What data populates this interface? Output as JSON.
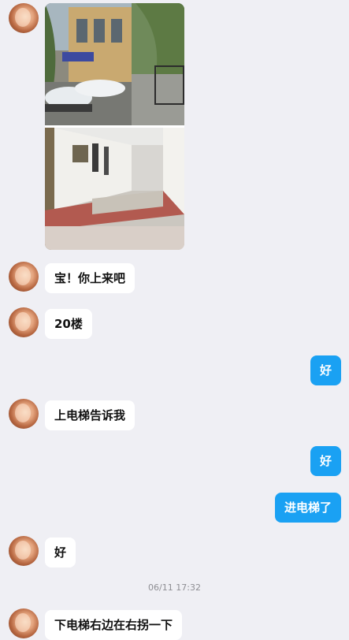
{
  "messages": {
    "m1": "宝！你上来吧",
    "m2": "20楼",
    "m3": "好",
    "m4": "上电梯告诉我",
    "m5": "好",
    "m6": "进电梯了",
    "m7": "好",
    "m8": "下电梯右边在右拐一下"
  },
  "timestamp": "06/11 17:32",
  "colors": {
    "background": "#efeff4",
    "incoming_bubble": "#ffffff",
    "outgoing_bubble": "#1aa1f3"
  }
}
